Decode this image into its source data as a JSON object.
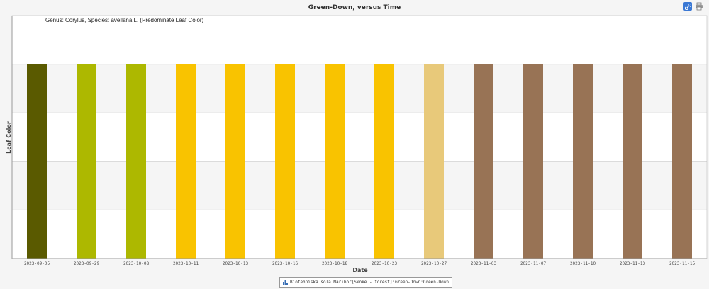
{
  "header": {
    "title": "Green-Down, versus Time"
  },
  "toolbar": {
    "link_icon": "link-icon",
    "print_icon": "printer-icon"
  },
  "chart_data": {
    "type": "bar",
    "title": "Green-Down, versus Time",
    "subtitle": "Genus: Corylus, Species: avellana L. (Predominate Leaf Color)",
    "xlabel": "Date",
    "ylabel": "Leaf Color",
    "categories": [
      "2023-09-05",
      "2023-09-29",
      "2023-10-08",
      "2023-10-11",
      "2023-10-13",
      "2023-10-16",
      "2023-10-18",
      "2023-10-23",
      "2023-10-27",
      "2023-11-03",
      "2023-11-07",
      "2023-11-10",
      "2023-11-13",
      "2023-11-15"
    ],
    "values": [
      4,
      4,
      4,
      4,
      4,
      4,
      4,
      4,
      4,
      4,
      4,
      4,
      4,
      4
    ],
    "colors": [
      "#5a5a00",
      "#adb800",
      "#adb800",
      "#f9c300",
      "#f9c300",
      "#f9c300",
      "#f9c300",
      "#f9c300",
      "#e8c97a",
      "#987355",
      "#987355",
      "#987355",
      "#987355",
      "#987355"
    ],
    "ylim": [
      0,
      5
    ],
    "grid": true,
    "legend": {
      "placement": "bottom-center",
      "label": "Biotehniška šola Maribor[Skoke - forest]:Green-Down:Green-Down",
      "icon": "bar-chart-icon"
    }
  }
}
